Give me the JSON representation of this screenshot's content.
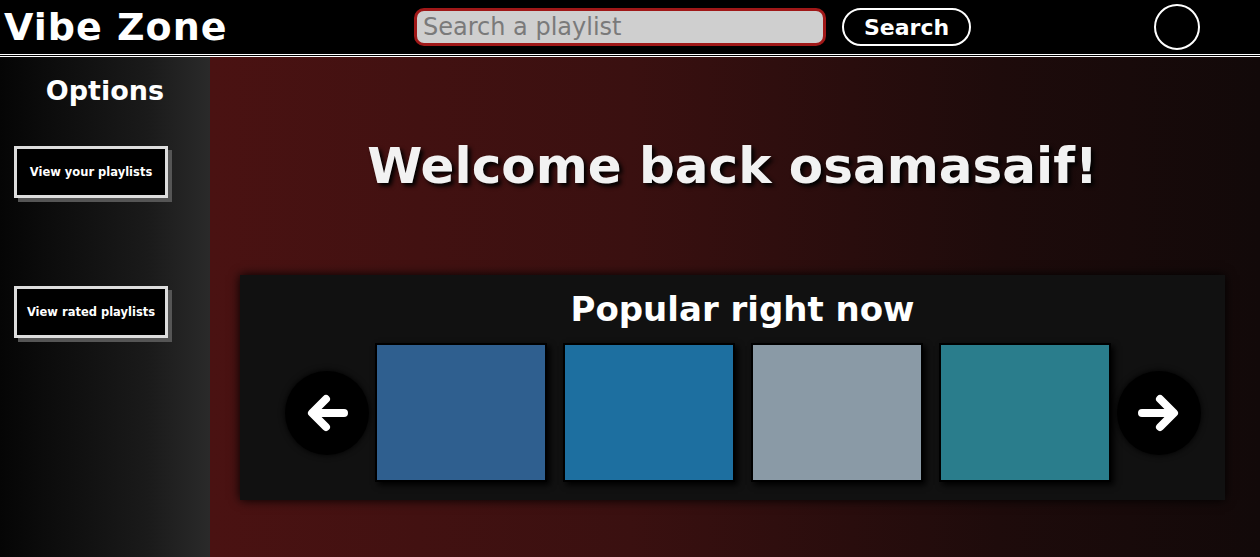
{
  "header": {
    "title": "Vibe Zone",
    "search": {
      "placeholder": "Search a playlist",
      "button": "Search"
    }
  },
  "sidebar": {
    "title": "Options",
    "items": [
      {
        "label": "View your playlists"
      },
      {
        "label": "View rated playlists"
      }
    ]
  },
  "welcome": "Welcome back osamasaif!",
  "popular": {
    "title": "Popular right now",
    "items": [
      {
        "color": "#2f5f8f"
      },
      {
        "color": "#1d6fa0"
      },
      {
        "color": "#8a9aa6"
      },
      {
        "color": "#2a7d8c"
      }
    ]
  }
}
